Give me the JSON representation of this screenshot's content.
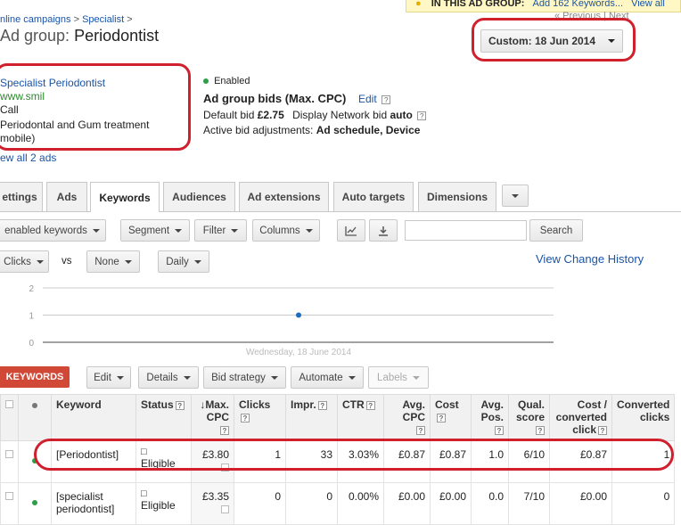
{
  "notice": {
    "label": "IN THIS AD GROUP:",
    "link": "Add 162 Keywords...",
    "view_all": "View all"
  },
  "pager": {
    "prev": "« Previous",
    "next": "Next"
  },
  "breadcrumb": {
    "part1": "nline campaigns",
    "sep1": ">",
    "part2": "Specialist",
    "sep2": ">"
  },
  "title": {
    "prefix": "Ad group:",
    "name": "Periodontist"
  },
  "date_range": "Custom: 18 Jun 2014",
  "ad": {
    "headline": "Specialist Periodontist",
    "url": "www.smil",
    "line1": "Call",
    "line2": "Periodontal and Gum treatment",
    "line3": "mobile)",
    "view_all": "ew all 2 ads"
  },
  "bids": {
    "status": "Enabled",
    "heading": "Ad group bids (Max. CPC)",
    "edit": "Edit",
    "default_label": "Default bid",
    "default_value": "£2.75",
    "display_label": "Display Network bid",
    "display_value": "auto",
    "adjust_label": "Active bid adjustments:",
    "adjust_value": "Ad schedule, Device"
  },
  "tabs": [
    "ettings",
    "Ads",
    "Keywords",
    "Audiences",
    "Ad extensions",
    "Auto targets",
    "Dimensions"
  ],
  "toolbar": {
    "filter_view": "enabled keywords",
    "segment": "Segment",
    "filter": "Filter",
    "columns": "Columns",
    "search": "Search",
    "search_value": ""
  },
  "chart_controls": {
    "metric1": "Clicks",
    "vs": "vs",
    "metric2": "None",
    "period": "Daily",
    "history": "View Change History"
  },
  "chart_data": {
    "type": "line",
    "x": [
      "Wednesday, 18 June 2014"
    ],
    "series": [
      {
        "values": [
          1
        ]
      }
    ],
    "yticks": [
      "2",
      "1",
      "0"
    ],
    "ylim": [
      0,
      2
    ],
    "xlabel": "Wednesday, 18 June 2014",
    "color": "#1c6ebd"
  },
  "actions": {
    "keywords": "KEYWORDS",
    "edit": "Edit",
    "details": "Details",
    "bid_strategy": "Bid strategy",
    "automate": "Automate",
    "labels": "Labels"
  },
  "table": {
    "headers": {
      "keyword": "Keyword",
      "status": "Status",
      "max_cpc": "Max. CPC",
      "clicks": "Clicks",
      "impr": "Impr.",
      "ctr": "CTR",
      "avg_cpc": "Avg. CPC",
      "cost": "Cost",
      "avg_pos": "Avg. Pos.",
      "qual": "Qual. score",
      "cost_conv": "Cost / converted click",
      "conv": "Converted clicks"
    },
    "rows": [
      {
        "keyword": "[Periodontist]",
        "status": "Eligible",
        "max_cpc": "£3.80",
        "clicks": "1",
        "impr": "33",
        "ctr": "3.03%",
        "avg_cpc": "£0.87",
        "cost": "£0.87",
        "avg_pos": "1.0",
        "qual": "6/10",
        "cost_conv": "£0.87",
        "conv": "1"
      },
      {
        "keyword": "[specialist periodontist]",
        "status": "Eligible",
        "max_cpc": "£3.35",
        "clicks": "0",
        "impr": "0",
        "ctr": "0.00%",
        "avg_cpc": "£0.00",
        "cost": "£0.00",
        "avg_pos": "0.0",
        "qual": "7/10",
        "cost_conv": "£0.00",
        "conv": "0"
      }
    ]
  }
}
